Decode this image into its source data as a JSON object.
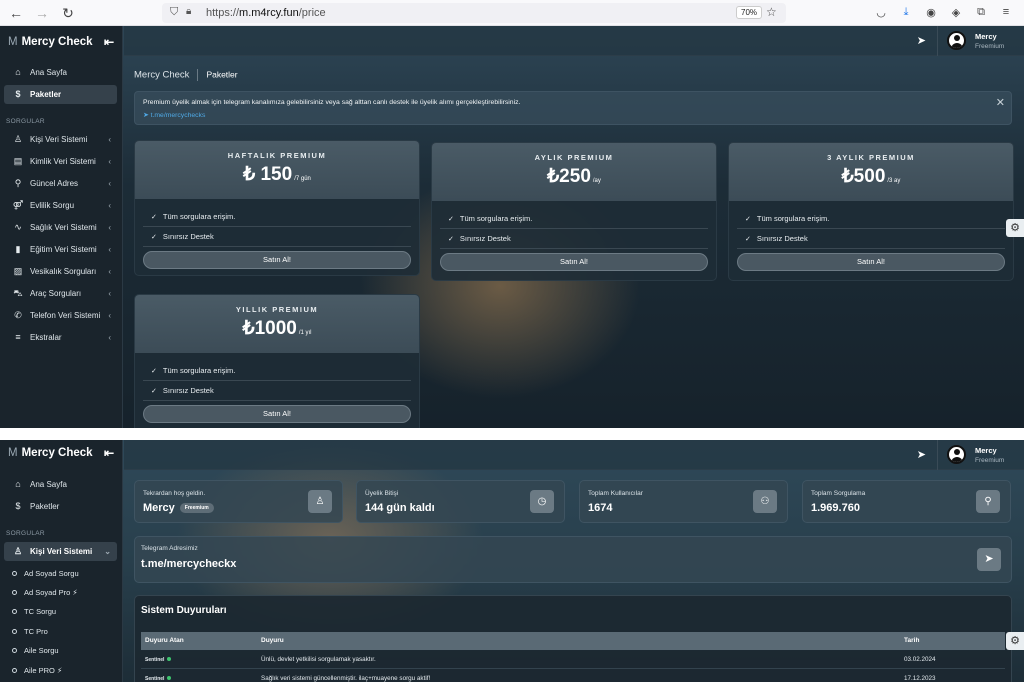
{
  "browser": {
    "url_scheme": "https://",
    "url_host": "m.m4rcy.fun",
    "url_path": "/price",
    "zoom": "70%"
  },
  "app": {
    "logo_letter": "M",
    "name": "Mercy Check"
  },
  "user": {
    "name": "Mercy",
    "role": "Freemium"
  },
  "sidebar": {
    "home": "Ana Sayfa",
    "packages": "Paketler",
    "section": "SORGULAR",
    "items": [
      "Kişi Veri Sistemi",
      "Kimlik Veri Sistemi",
      "Güncel Adres",
      "Evlilik Sorgu",
      "Sağlık Veri Sistemi",
      "Eğitim Veri Sistemi",
      "Vesikalık Sorguları",
      "Araç Sorguları",
      "Telefon Veri Sistemi",
      "Ekstralar"
    ],
    "subitems": [
      "Ad Soyad Sorgu",
      "Ad Soyad Pro",
      "TC Sorgu",
      "TC Pro",
      "Aile Sorgu",
      "Aile PRO"
    ]
  },
  "breadcrumb": {
    "root": "Mercy Check",
    "current": "Paketler"
  },
  "alert": {
    "text": "Premium üyelik almak için telegram kanalımıza gelebilirsiniz veya sağ alttan canlı destek ile üyelik alımı gerçekleştirebilirsiniz.",
    "link": "t.me/mercychecks"
  },
  "plans": [
    {
      "name": "HAFTALIK PREMIUM",
      "price": "₺ 150",
      "period": "/7 gün",
      "features": [
        "Tüm sorgulara erişim.",
        "Sınırsız Destek"
      ],
      "button": "Satın Al!"
    },
    {
      "name": "AYLIK PREMIUM",
      "price": "₺250",
      "period": "/ay",
      "features": [
        "Tüm sorgulara erişim.",
        "Sınırsız Destek"
      ],
      "button": "Satın Al!"
    },
    {
      "name": "3 AYLIK PREMIUM",
      "price": "₺500",
      "period": "/3 ay",
      "features": [
        "Tüm sorgulara erişim.",
        "Sınırsız Destek"
      ],
      "button": "Satın Al!"
    },
    {
      "name": "YILLIK PREMIUM",
      "price": "₺1000",
      "period": "/1 yıl",
      "features": [
        "Tüm sorgulara erişim.",
        "Sınırsız Destek"
      ],
      "button": "Satın Al!"
    }
  ],
  "dashboard": {
    "welcome_label": "Tekrardan hoş geldin.",
    "welcome_name": "Mercy",
    "welcome_badge": "Freemium",
    "expiry_label": "Üyelik Bitişi",
    "expiry_value": "144 gün kaldı",
    "users_label": "Toplam Kullanıcılar",
    "users_value": "1674",
    "queries_label": "Toplam Sorgulama",
    "queries_value": "1.969.760",
    "telegram_label": "Telegram Adresimiz",
    "telegram_value": "t.me/mercycheckx"
  },
  "announcements": {
    "title": "Sistem Duyuruları",
    "headers": [
      "Duyuru Atan",
      "Duyuru",
      "Tarih"
    ],
    "rows": [
      {
        "author": "Sentinel",
        "text": "Ünlü, devlet yetkilisi sorgulamak yasaktır.",
        "date": "03.02.2024"
      },
      {
        "author": "Sentinel",
        "text": "Sağlık veri sistemi güncellenmiştir. ilaç+muayene sorgu aktif!",
        "date": "17.12.2023"
      }
    ]
  }
}
